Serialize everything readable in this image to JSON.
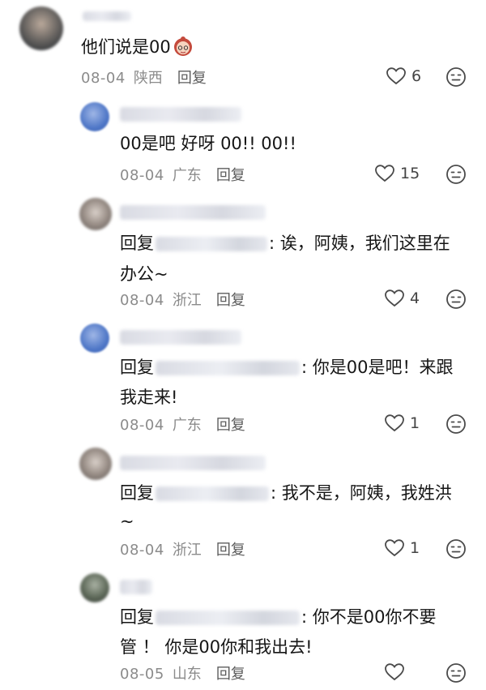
{
  "comments": [
    {
      "text": "他们说是00",
      "date": "08-04",
      "region": "陕西",
      "reply_label": "回复",
      "likes": "6",
      "emoji": "girl-emoji"
    },
    {
      "text": "00是吧  好呀  00!!  00!!",
      "date": "08-04",
      "region": "广东",
      "reply_label": "回复",
      "likes": "15"
    },
    {
      "reply_prefix": "回复",
      "text_line1": ": 诶，阿姨，我们这里在",
      "text_line2": "办公~",
      "date": "08-04",
      "region": "浙江",
      "reply_label": "回复",
      "likes": "4"
    },
    {
      "reply_prefix": "回复",
      "text_line1": ": 你是00是吧！来跟",
      "text_line2": "我走来!",
      "date": "08-04",
      "region": "广东",
      "reply_label": "回复",
      "likes": "1"
    },
    {
      "reply_prefix": "回复",
      "text_line1": ": 我不是，阿姨，我姓洪",
      "text_line2": "~",
      "date": "08-04",
      "region": "浙江",
      "reply_label": "回复",
      "likes": "1"
    },
    {
      "reply_prefix": "回复",
      "text_line1": ": 你不是00你不要",
      "text_line2": "管  ！ 你是00你和我出去!",
      "date": "08-05",
      "region": "山东",
      "reply_label": "回复",
      "likes": ""
    }
  ],
  "icons": {
    "like": "heart-outline-icon",
    "dislike": "meh-face-icon"
  },
  "colors": {
    "text": "#161616",
    "meta": "#8b8b8b",
    "icon": "#4a4a4a"
  }
}
